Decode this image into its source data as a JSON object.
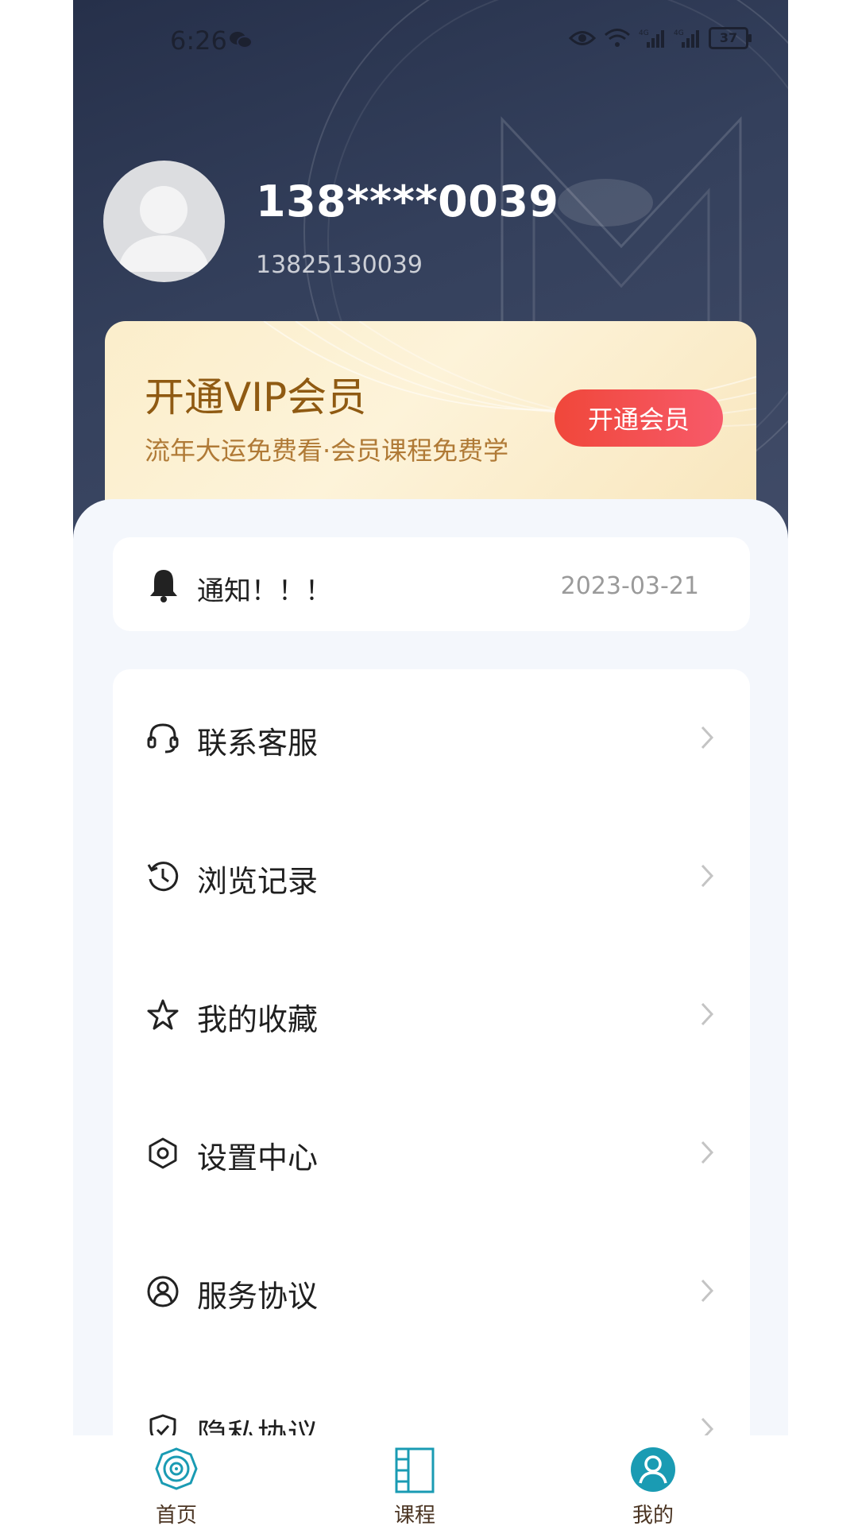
{
  "status_bar": {
    "time": "6:26",
    "battery": "37",
    "network": "4G"
  },
  "profile": {
    "masked_phone": "138****0039",
    "phone": "13825130039"
  },
  "vip": {
    "title": "开通VIP会员",
    "subtitle": "流年大运免费看·会员课程免费学",
    "button": "开通会员"
  },
  "notice": {
    "text": "通知！！！",
    "date": "2023-03-21"
  },
  "menu": [
    {
      "label": "联系客服",
      "icon": "headset-icon"
    },
    {
      "label": "浏览记录",
      "icon": "history-icon"
    },
    {
      "label": "我的收藏",
      "icon": "star-icon"
    },
    {
      "label": "设置中心",
      "icon": "settings-icon"
    },
    {
      "label": "服务协议",
      "icon": "user-circle-icon"
    },
    {
      "label": "隐私协议",
      "icon": "shield-check-icon"
    }
  ],
  "tabs": [
    {
      "label": "首页",
      "icon": "bagua-icon"
    },
    {
      "label": "课程",
      "icon": "book-icon"
    },
    {
      "label": "我的",
      "icon": "person-icon",
      "active": true
    }
  ],
  "colors": {
    "header": "#2d3752",
    "accent": "#1a9bb3",
    "vip_button": "#f0473a"
  }
}
